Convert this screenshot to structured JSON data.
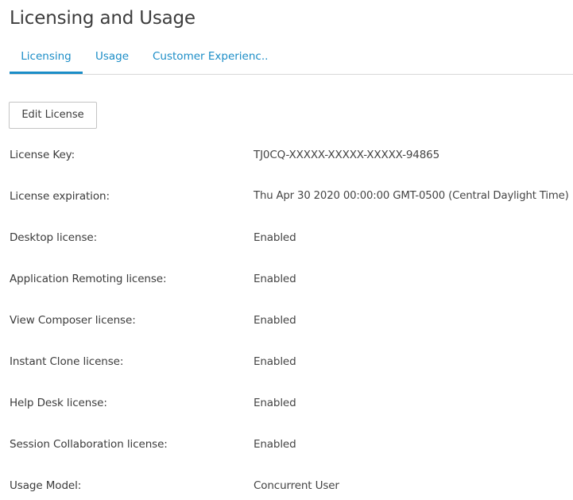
{
  "page": {
    "title": "Licensing and Usage"
  },
  "tabs": [
    {
      "label": "Licensing",
      "active": true
    },
    {
      "label": "Usage",
      "active": false
    },
    {
      "label": "Customer Experienc...",
      "active": false
    }
  ],
  "toolbar": {
    "edit_label": "Edit License"
  },
  "details": [
    {
      "label": "License Key:",
      "value": "TJ0CQ-XXXXX-XXXXX-XXXXX-94865"
    },
    {
      "label": "License expiration:",
      "value": "Thu Apr 30 2020 00:00:00 GMT-0500 (Central Daylight Time)"
    },
    {
      "label": "Desktop license:",
      "value": "Enabled"
    },
    {
      "label": "Application Remoting license:",
      "value": "Enabled"
    },
    {
      "label": "View Composer license:",
      "value": "Enabled"
    },
    {
      "label": "Instant Clone license:",
      "value": "Enabled"
    },
    {
      "label": "Help Desk license:",
      "value": "Enabled"
    },
    {
      "label": "Session Collaboration license:",
      "value": "Enabled"
    },
    {
      "label": "Usage Model:",
      "value": "Concurrent User"
    }
  ],
  "colors": {
    "accent": "#1b8dc7",
    "text": "#3b3b3b",
    "divider": "#d8d8d8"
  }
}
